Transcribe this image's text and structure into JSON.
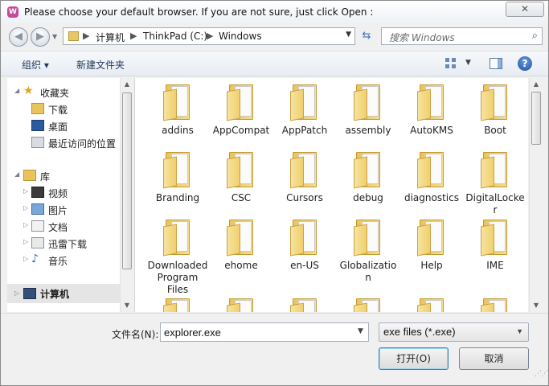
{
  "window": {
    "title": "Please choose your default browser. If you are not sure, just click Open :",
    "close_glyph": "✕",
    "app_icon_glyph": "W"
  },
  "navbar": {
    "back_glyph": "◀",
    "forward_glyph": "▶",
    "address": {
      "crumbs": [
        "计算机",
        "ThinkPad (C:)",
        "Windows"
      ],
      "separator": "▶"
    },
    "search_placeholder": "搜索 Windows"
  },
  "toolbar": {
    "organize": "组织 ▾",
    "new_folder": "新建文件夹",
    "help_glyph": "?"
  },
  "tree": {
    "favorites": {
      "label": "收藏夹",
      "children": [
        "下载",
        "桌面",
        "最近访问的位置"
      ]
    },
    "libraries": {
      "label": "库",
      "children": [
        "视频",
        "图片",
        "文档",
        "迅雷下载",
        "音乐"
      ]
    },
    "computer": {
      "label": "计算机"
    }
  },
  "items": [
    "addins",
    "AppCompat",
    "AppPatch",
    "assembly",
    "AutoKMS",
    "Boot",
    "Branding",
    "CSC",
    "Cursors",
    "debug",
    "diagnostics",
    "DigitalLocker",
    "Downloaded Program Files",
    "ehome",
    "en-US",
    "Globalization",
    "Help",
    "IME",
    "",
    "",
    "",
    "",
    "",
    ""
  ],
  "bottom": {
    "filename_label": "文件名(N):",
    "filename_value": "explorer.exe",
    "filetype_value": "exe files (*.exe)",
    "open_label": "打开(O)",
    "cancel_label": "取消"
  },
  "colors": {
    "folder": "#f0cf6c",
    "selected_tree": "#e5e5e5",
    "accent": "#3c7fb1"
  }
}
